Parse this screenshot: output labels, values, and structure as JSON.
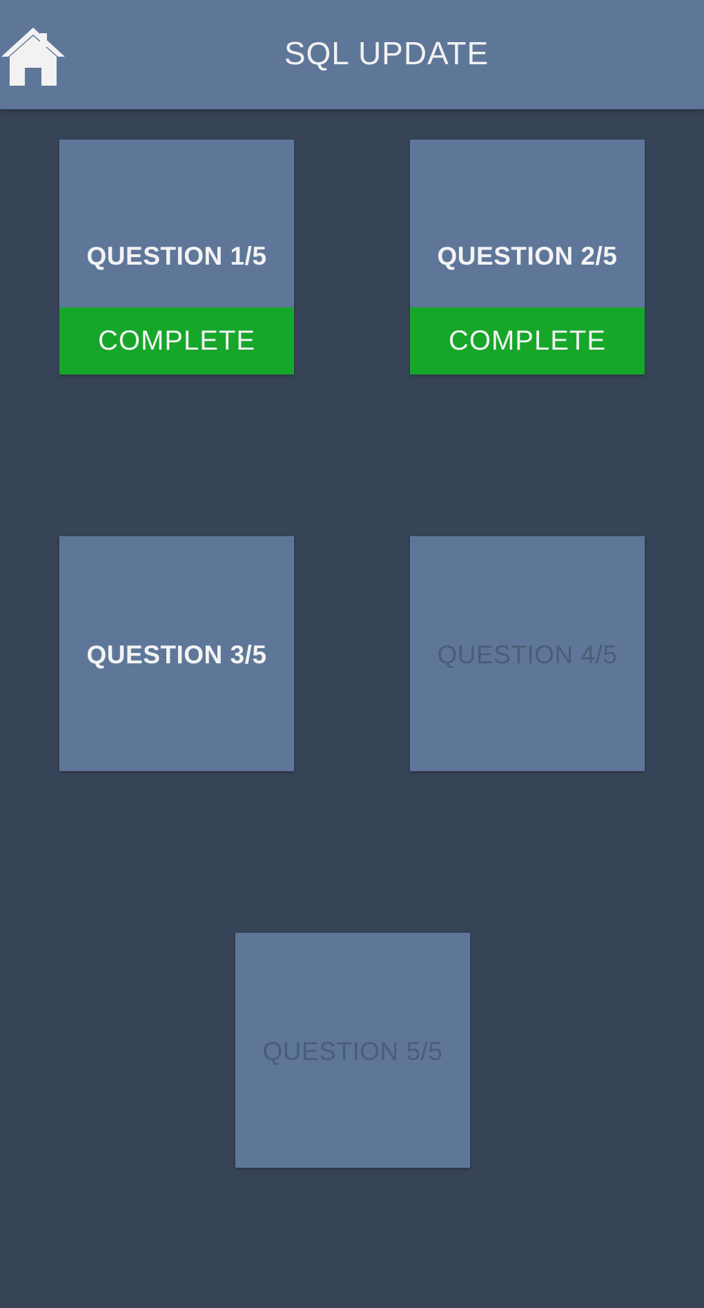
{
  "header": {
    "title": "SQL UPDATE",
    "home_icon": "home-icon"
  },
  "colors": {
    "background": "#374357",
    "tile": "#5e7799",
    "complete": "#16a72a",
    "text_enabled": "#f3f3f3",
    "text_locked": "#4b5d77"
  },
  "questions": [
    {
      "label": "QUESTION 1/5",
      "status": "COMPLETE"
    },
    {
      "label": "QUESTION 2/5",
      "status": "COMPLETE"
    },
    {
      "label": "QUESTION 3/5",
      "status": ""
    },
    {
      "label": "QUESTION 4/5",
      "status": ""
    },
    {
      "label": "QUESTION 5/5",
      "status": ""
    }
  ]
}
